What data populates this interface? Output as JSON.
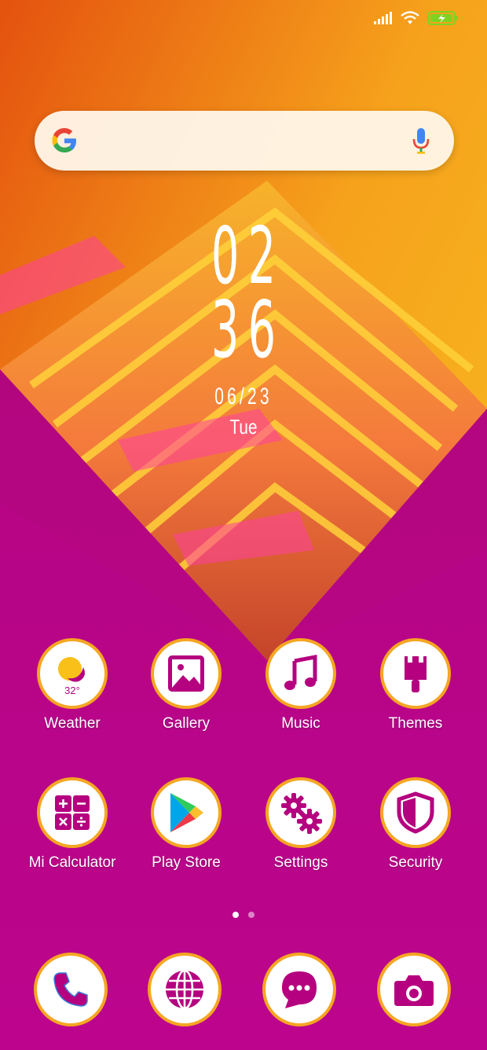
{
  "status_bar": {
    "icons": [
      "signal-icon",
      "wifi-icon",
      "battery-charging-icon"
    ],
    "battery_color": "#7ed321"
  },
  "search_bar": {
    "logo": "google-logo-icon",
    "placeholder": "",
    "mic": "mic-icon"
  },
  "clock_widget": {
    "hours": "02",
    "minutes": "36",
    "date": "06/23",
    "weekday": "Tue"
  },
  "apps_row_1": [
    {
      "label": "Weather",
      "icon": "weather-icon",
      "temp": "32°"
    },
    {
      "label": "Gallery",
      "icon": "gallery-icon"
    },
    {
      "label": "Music",
      "icon": "music-icon"
    },
    {
      "label": "Themes",
      "icon": "themes-icon"
    }
  ],
  "apps_row_2": [
    {
      "label": "Mi Calculator",
      "icon": "calculator-icon"
    },
    {
      "label": "Play Store",
      "icon": "play-store-icon"
    },
    {
      "label": "Settings",
      "icon": "settings-icon"
    },
    {
      "label": "Security",
      "icon": "security-icon"
    }
  ],
  "page_indicator": {
    "pages": 2,
    "current": 1
  },
  "dock": [
    {
      "icon": "phone-icon"
    },
    {
      "icon": "browser-icon"
    },
    {
      "icon": "messages-icon"
    },
    {
      "icon": "camera-icon"
    }
  ],
  "colors": {
    "accent": "#b5007f",
    "ring": "#f5a623",
    "wallpaper_top": "#f59a1b"
  }
}
